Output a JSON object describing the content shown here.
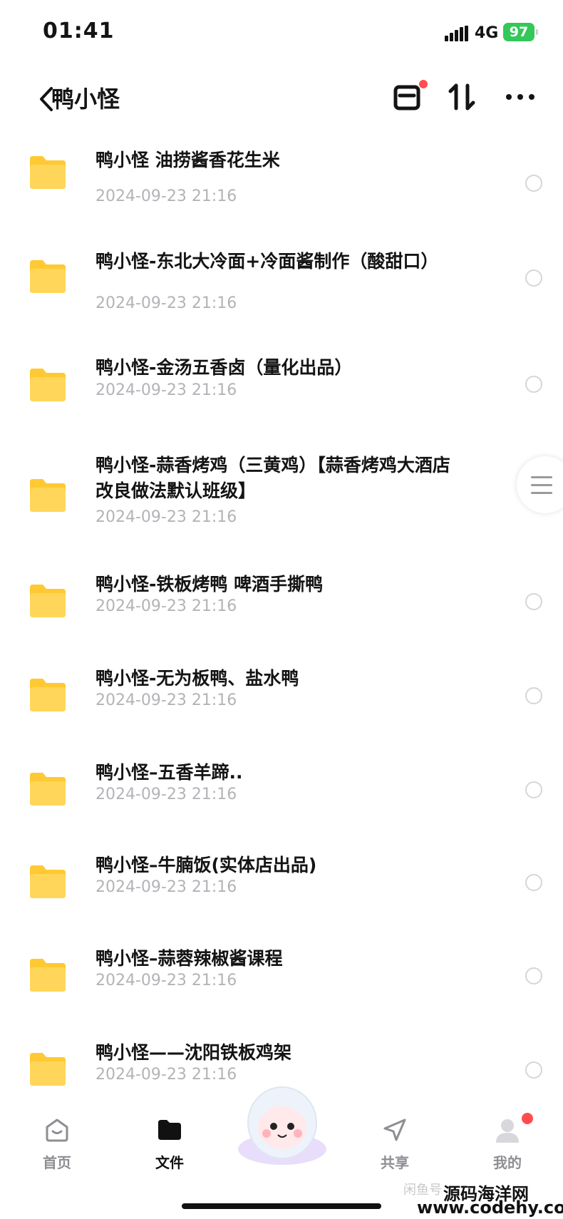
{
  "status": {
    "time": "01:41",
    "network": "4G",
    "battery": "97"
  },
  "nav": {
    "title": "鸭小怪"
  },
  "files": [
    {
      "name": "鸭小怪 油捞酱香花生米",
      "date": "2024-09-23 21:16"
    },
    {
      "name": "鸭小怪-东北大冷面+冷面酱制作（酸甜口）",
      "date": "2024-09-23 21:16"
    },
    {
      "name": "鸭小怪-金汤五香卤（量化出品）",
      "date": "2024-09-23 21:16"
    },
    {
      "name": "鸭小怪-蒜香烤鸡（三黄鸡）【蒜香烤鸡大酒店改良做法默认班级】",
      "date": "2024-09-23 21:16"
    },
    {
      "name": "鸭小怪-铁板烤鸭 啤酒手撕鸭",
      "date": "2024-09-23 21:16"
    },
    {
      "name": "鸭小怪-无为板鸭、盐水鸭",
      "date": "2024-09-23 21:16"
    },
    {
      "name": "鸭小怪–五香羊蹄..",
      "date": "2024-09-23 21:16"
    },
    {
      "name": "鸭小怪–牛腩饭(实体店出品)",
      "date": "2024-09-23 21:16"
    },
    {
      "name": "鸭小怪–蒜蓉辣椒酱课程",
      "date": "2024-09-23 21:16"
    },
    {
      "name": "鸭小怪——沈阳铁板鸡架",
      "date": "2024-09-23 21:16"
    }
  ],
  "tabs": [
    {
      "label": "首页",
      "icon": "home-icon"
    },
    {
      "label": "文件",
      "icon": "folder-icon"
    },
    {
      "label": "共享",
      "icon": "send-icon"
    },
    {
      "label": "我的",
      "icon": "user-icon"
    }
  ],
  "watermark": {
    "line1": "闲鱼号",
    "line2": "源码海洋网",
    "line3": "www.codehy.com"
  },
  "colors": {
    "folder": "#ffc933",
    "badge": "#ff4d4f",
    "battery": "#34c759"
  }
}
